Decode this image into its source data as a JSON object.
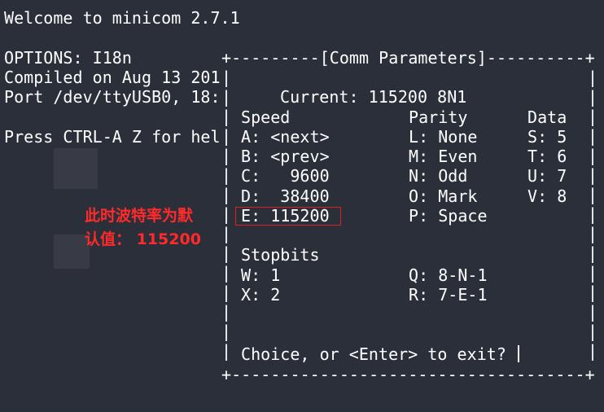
{
  "terminal": {
    "welcome": "Welcome to minicom 2.7.1",
    "options": "OPTIONS: I18n",
    "compiled": "Compiled on Aug 13 201",
    "port": "Port /dev/ttyUSB0, 18:",
    "press": "Press CTRL-A Z for hel"
  },
  "dialog": {
    "border_top": "+---------[Comm Parameters]----------+",
    "border_bottom": "+------------------------------------+",
    "current": "Current: 115200 8N1",
    "headers": {
      "speed": "Speed",
      "parity": "Parity",
      "data": "Data"
    },
    "speed_options": [
      "A: <next>",
      "B: <prev>",
      "C:   9600",
      "D:  38400",
      "E: 115200"
    ],
    "parity_options": [
      "L: None",
      "M: Even",
      "N: Odd",
      "O: Mark",
      "P: Space"
    ],
    "data_options": [
      "S: 5",
      "T: 6",
      "U: 7",
      "V: 8"
    ],
    "stopbits_header": "Stopbits",
    "stopbits_options": [
      "W: 1",
      "X: 2"
    ],
    "preset_options": [
      "Q: 8-N-1",
      "R: 7-E-1"
    ],
    "prompt": "Choice, or <Enter> to exit?"
  },
  "annotation": {
    "line1": "此时波特率为默",
    "line2": "认值： 115200",
    "color": "#ff2a2a"
  },
  "colors": {
    "background": "#2b2f3a",
    "text": "#ffffff"
  }
}
